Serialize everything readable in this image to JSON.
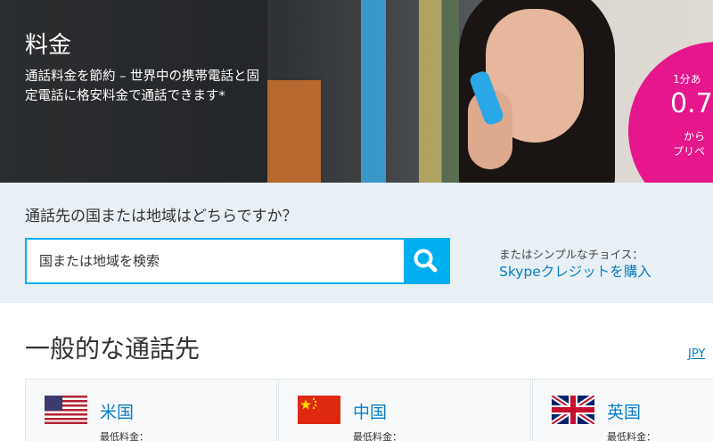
{
  "hero": {
    "title": "料金",
    "subtitle": "通話料金を節約 – 世界中の携帯電話と固定電話に格安料金で通話できます*"
  },
  "promo": {
    "line1": "1分あ",
    "price": "0.7",
    "line3": "から",
    "line4": "プリペ",
    "color": "#e6168c"
  },
  "search": {
    "question": "通話先の国または地域はどちらですか？",
    "placeholder": "国または地域を検索",
    "button_icon": "search-icon",
    "alt_label": "またはシンプルなチョイス：",
    "alt_link": "Skypeクレジットを購入"
  },
  "popular": {
    "title": "一般的な通話先",
    "currency": "JPY",
    "cards": [
      {
        "name": "米国",
        "min_label": "最低料金：",
        "flag": "us-flag-icon"
      },
      {
        "name": "中国",
        "min_label": "最低料金：",
        "flag": "cn-flag-icon"
      },
      {
        "name": "英国",
        "min_label": "最低料金：",
        "flag": "uk-flag-icon"
      }
    ]
  },
  "colors": {
    "accent": "#00aff0",
    "link": "#0b7dc6",
    "band": "#e8f0f5"
  }
}
